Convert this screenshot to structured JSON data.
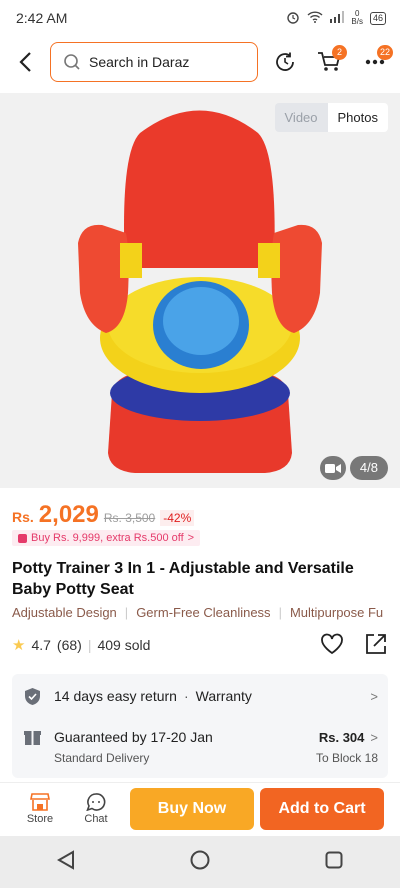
{
  "status_bar": {
    "time": "2:42 AM",
    "net_speed_value": "0",
    "net_speed_unit": "B/s",
    "battery": "46"
  },
  "header": {
    "search_placeholder": "Search in Daraz",
    "cart_count": "2",
    "more_count": "22"
  },
  "gallery": {
    "toggle_video": "Video",
    "toggle_photos": "Photos",
    "counter": "4/8"
  },
  "price": {
    "currency": "Rs.",
    "current": "2,029",
    "original": "Rs. 3,500",
    "discount": "-42%"
  },
  "promo": {
    "text": "Buy Rs. 9,999, extra Rs.500 off",
    "chevron": ">"
  },
  "product": {
    "title": "Potty Trainer 3 In 1 - Adjustable and Versatile Baby Potty Seat"
  },
  "tags": [
    "Adjustable Design",
    "Germ-Free Cleanliness",
    "Multipurpose Fu"
  ],
  "rating": {
    "score": "4.7",
    "count": "(68)",
    "sold": "409 sold"
  },
  "service": {
    "return": "14 days easy return",
    "separator": "·",
    "warranty": "Warranty"
  },
  "delivery": {
    "guarantee": "Guaranteed by 17-20 Jan",
    "type": "Standard Delivery",
    "fee": "Rs. 304",
    "destination": "To Block 18"
  },
  "action_bar": {
    "store_label": "Store",
    "chat_label": "Chat",
    "buy_now": "Buy Now",
    "add_to_cart": "Add to Cart"
  },
  "colors": {
    "accent": "#f57224",
    "buy_now": "#f9a825",
    "add_to_cart": "#f26522",
    "promo": "#e53a6a"
  }
}
